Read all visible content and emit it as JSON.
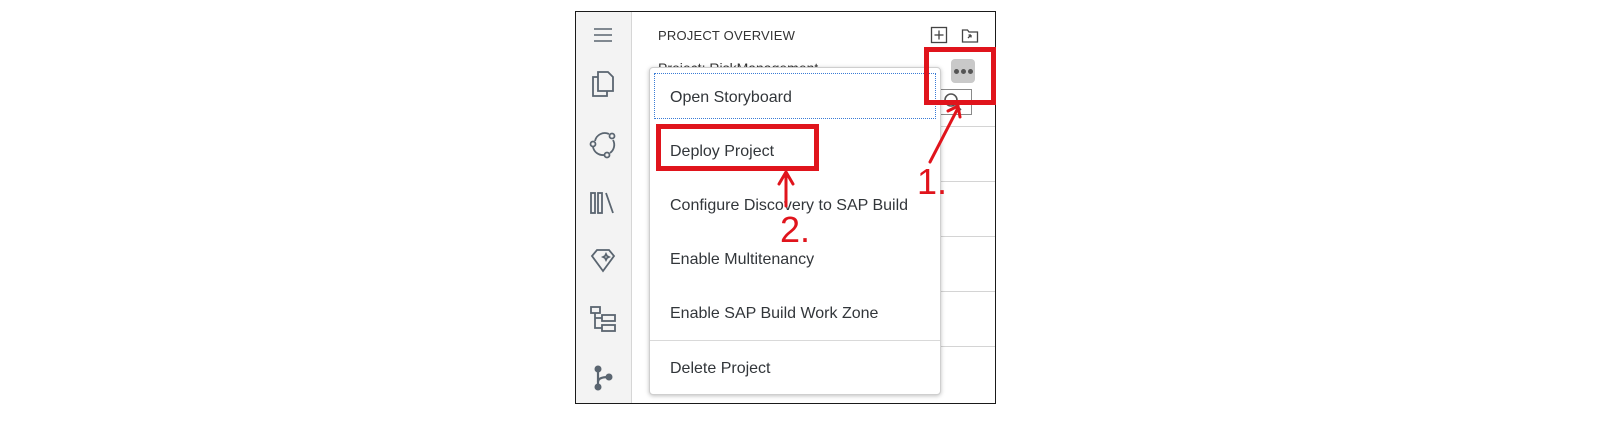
{
  "panel": {
    "title": "PROJECT OVERVIEW",
    "project_line": "Project: RiskManagement"
  },
  "activity_bar": {
    "icons": [
      "menu-icon",
      "explorer-icon",
      "source-control-icon",
      "library-icon",
      "extensions-icon",
      "hierarchy-icon",
      "git-branch-icon"
    ]
  },
  "toolbar": {
    "icons": [
      "add-icon",
      "open-folder-icon",
      "more-options-icon"
    ]
  },
  "context_menu": {
    "items": [
      {
        "label": "Open Storyboard"
      },
      {
        "label": "Deploy Project"
      },
      {
        "label": "Configure Discovery to SAP Build"
      },
      {
        "label": "Enable Multitenancy"
      },
      {
        "label": "Enable SAP Build Work Zone"
      },
      {
        "label": "Delete Project"
      }
    ]
  },
  "annotations": {
    "step1": "1.",
    "step2": "2.",
    "color": "#e0141c"
  }
}
